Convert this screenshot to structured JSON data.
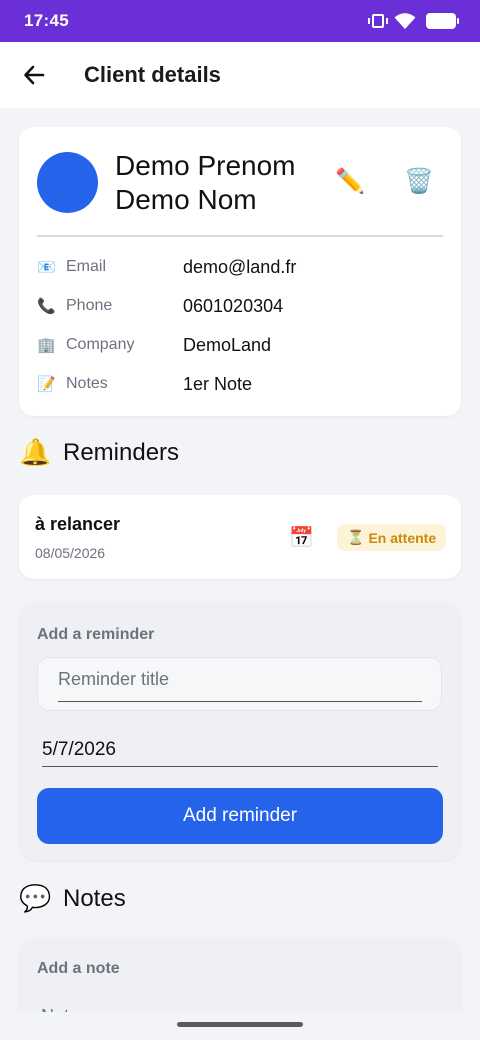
{
  "status_bar": {
    "time": "17:45"
  },
  "app_bar": {
    "title": "Client details"
  },
  "client": {
    "name": "Demo Prenom Demo Nom",
    "avatar_color": "#2563eb",
    "edit_icon": "✏️",
    "delete_icon": "🗑️",
    "fields": [
      {
        "icon": "📧",
        "label": "Email",
        "value": "demo@land.fr"
      },
      {
        "icon": "📞",
        "label": "Phone",
        "value": "0601020304"
      },
      {
        "icon": "🏢",
        "label": "Company",
        "value": "DemoLand"
      },
      {
        "icon": "📝",
        "label": "Notes",
        "value": "1er Note"
      }
    ]
  },
  "reminders": {
    "icon": "🔔",
    "title": "Reminders",
    "items": [
      {
        "title": "à relancer",
        "date": "08/05/2026",
        "calendar_icon": "📅",
        "status_icon": "⏳",
        "status": "En attente"
      }
    ]
  },
  "add_reminder": {
    "label": "Add a reminder",
    "title_placeholder": "Reminder title",
    "date_value": "5/7/2026",
    "button_label": "Add reminder"
  },
  "notes": {
    "icon": "💬",
    "title": "Notes",
    "add_label": "Add a note",
    "input_placeholder": "Note"
  },
  "colors": {
    "status_bar": "#6a2fd6",
    "primary": "#2563eb",
    "badge_bg": "#fdf3d6",
    "badge_text": "#c98a10"
  }
}
